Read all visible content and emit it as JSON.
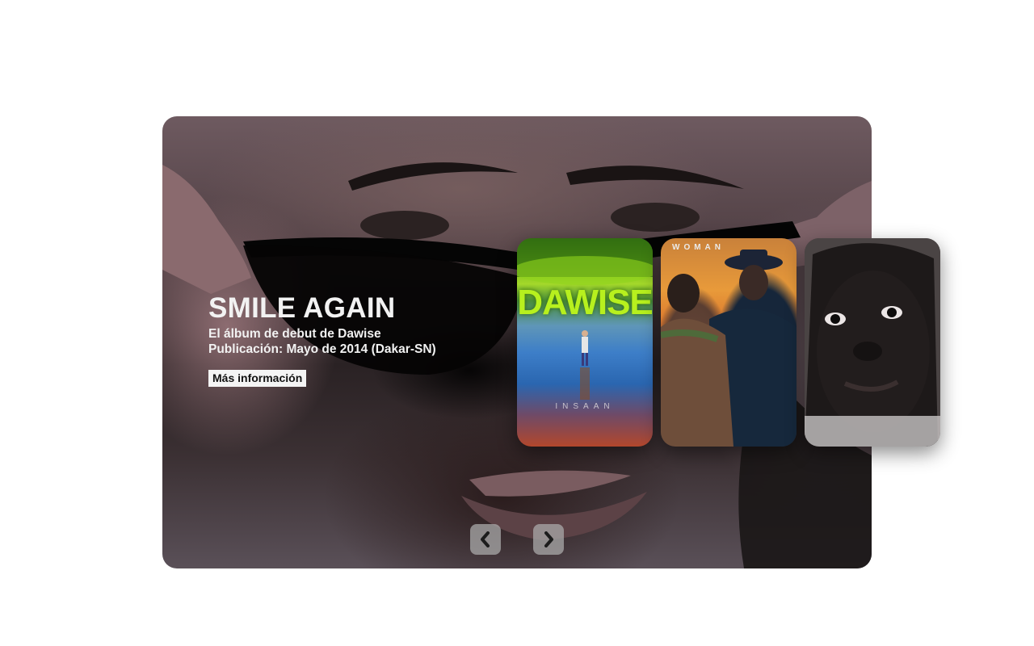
{
  "slider": {
    "title": "SMILE AGAIN",
    "subtitle_line1": "El álbum de debut de Dawise",
    "subtitle_line2": "Publicación: Mayo de 2014 (Dakar-SN)",
    "more_button": "Más información",
    "prev_icon": "chevron-left-icon",
    "next_icon": "chevron-right-icon"
  },
  "cards": [
    {
      "name": "album-card-dawise",
      "title": "DAWISE",
      "label": "INSAAN"
    },
    {
      "name": "album-card-woman",
      "label": "WOMAN"
    },
    {
      "name": "album-card-portrait"
    }
  ],
  "colors": {
    "nav_button": "#aaaaaa",
    "title_text": "#f2f2f2",
    "dawise_green": "#b7f01e"
  }
}
